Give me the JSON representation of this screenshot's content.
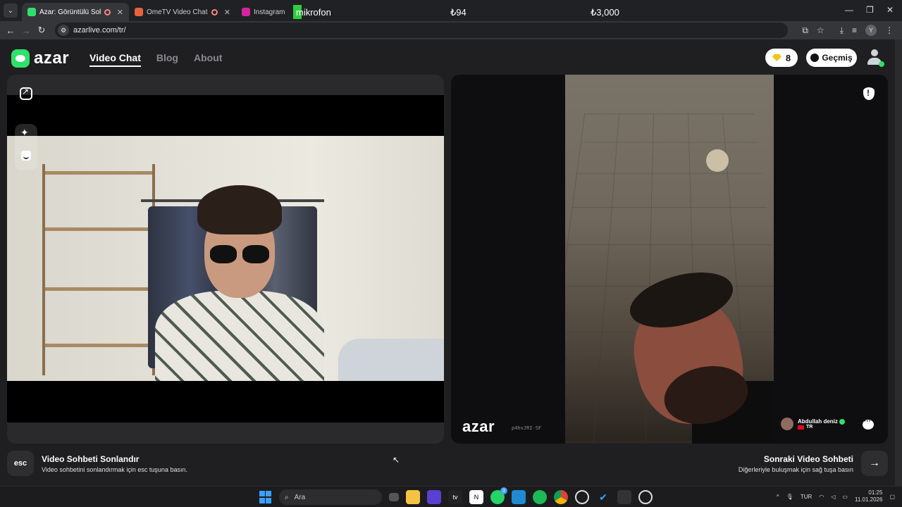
{
  "browser": {
    "tabs": [
      {
        "title": "Azar: Görüntülü Sohbet & V",
        "favicon_color": "#2fe06b",
        "active": true
      },
      {
        "title": "OmeTV Video Chat — Ome",
        "favicon_color": "#e8613c",
        "active": false
      },
      {
        "title": "Instagram",
        "favicon_color": "#d6249f",
        "active": false
      }
    ],
    "url": "azarlive.com/tr/",
    "profile_letter": "Y"
  },
  "overlay": {
    "mic_label": "mikrofon",
    "price_1": "₺94",
    "price_2": "₺3,000"
  },
  "header": {
    "logo_text": "azar",
    "nav": [
      {
        "label": "Video Chat",
        "active": true
      },
      {
        "label": "Blog",
        "active": false
      },
      {
        "label": "About",
        "active": false
      }
    ],
    "gems": "8",
    "history_label": "Geçmiş",
    "brand_color": "#2fe06b",
    "gem_color": "#f7c21a"
  },
  "remote": {
    "watermark": "azar",
    "watermark_id": "p4hvJRI-SF",
    "peer_name": "Abdullah deniz",
    "peer_country": "TR"
  },
  "footer": {
    "esc_key": "esc",
    "end_title": "Video Sohbeti Sonlandır",
    "end_desc": "Video sohbetini sonlandırmak için esc tuşuna basın.",
    "next_title": "Sonraki Video Sohbeti",
    "next_desc": "Diğerleriyle buluşmak için sağ tuşa basın"
  },
  "taskbar": {
    "search_placeholder": "Ara",
    "whatsapp_badge": "3",
    "lang": "TUR",
    "time": "01:25",
    "date": "11.01.2026"
  },
  "icons": [
    "expand-icon",
    "sparkle-icon",
    "face-filter-icon",
    "report-icon",
    "chat-icon",
    "arrow-right-icon",
    "clock-icon",
    "gem-icon",
    "user-icon"
  ]
}
